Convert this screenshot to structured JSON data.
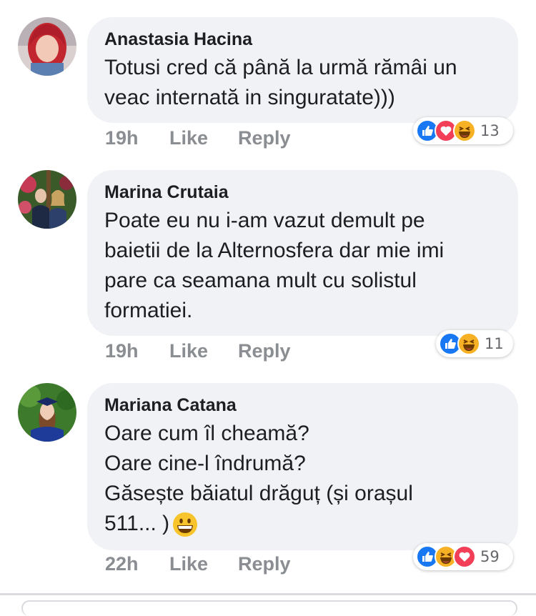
{
  "comments": [
    {
      "author": "Anastasia Hacina",
      "lines": [
        "Totusi cred că până la urmă rămâi un",
        "veac internată in singuratate)))"
      ],
      "time": "19h",
      "like_label": "Like",
      "reply_label": "Reply",
      "reactions": [
        "like",
        "love",
        "haha"
      ],
      "reaction_count": "13"
    },
    {
      "author": "Marina Crutaia",
      "lines": [
        "Poate eu nu i-am vazut demult pe",
        "baietii de la Alternosfera dar mie imi",
        "pare ca seamana mult cu solistul",
        "formatiei."
      ],
      "time": "19h",
      "like_label": "Like",
      "reply_label": "Reply",
      "reactions": [
        "like",
        "haha"
      ],
      "reaction_count": "11"
    },
    {
      "author": "Mariana Catana",
      "lines": [
        "Oare cum îl cheamă?",
        "Oare cine-l îndrumă?",
        "Găsește băiatul drăguț (și orașul",
        "511... )"
      ],
      "trailing_emoji": "grinning-face",
      "time": "22h",
      "like_label": "Like",
      "reply_label": "Reply",
      "reactions": [
        "like",
        "haha",
        "love"
      ],
      "reaction_count": "59"
    }
  ],
  "colors": {
    "bubble": "#f0f2f5",
    "meta": "#8a8d91",
    "like": "#1877f2",
    "love": "#f33e58",
    "haha": "#f7b125"
  }
}
